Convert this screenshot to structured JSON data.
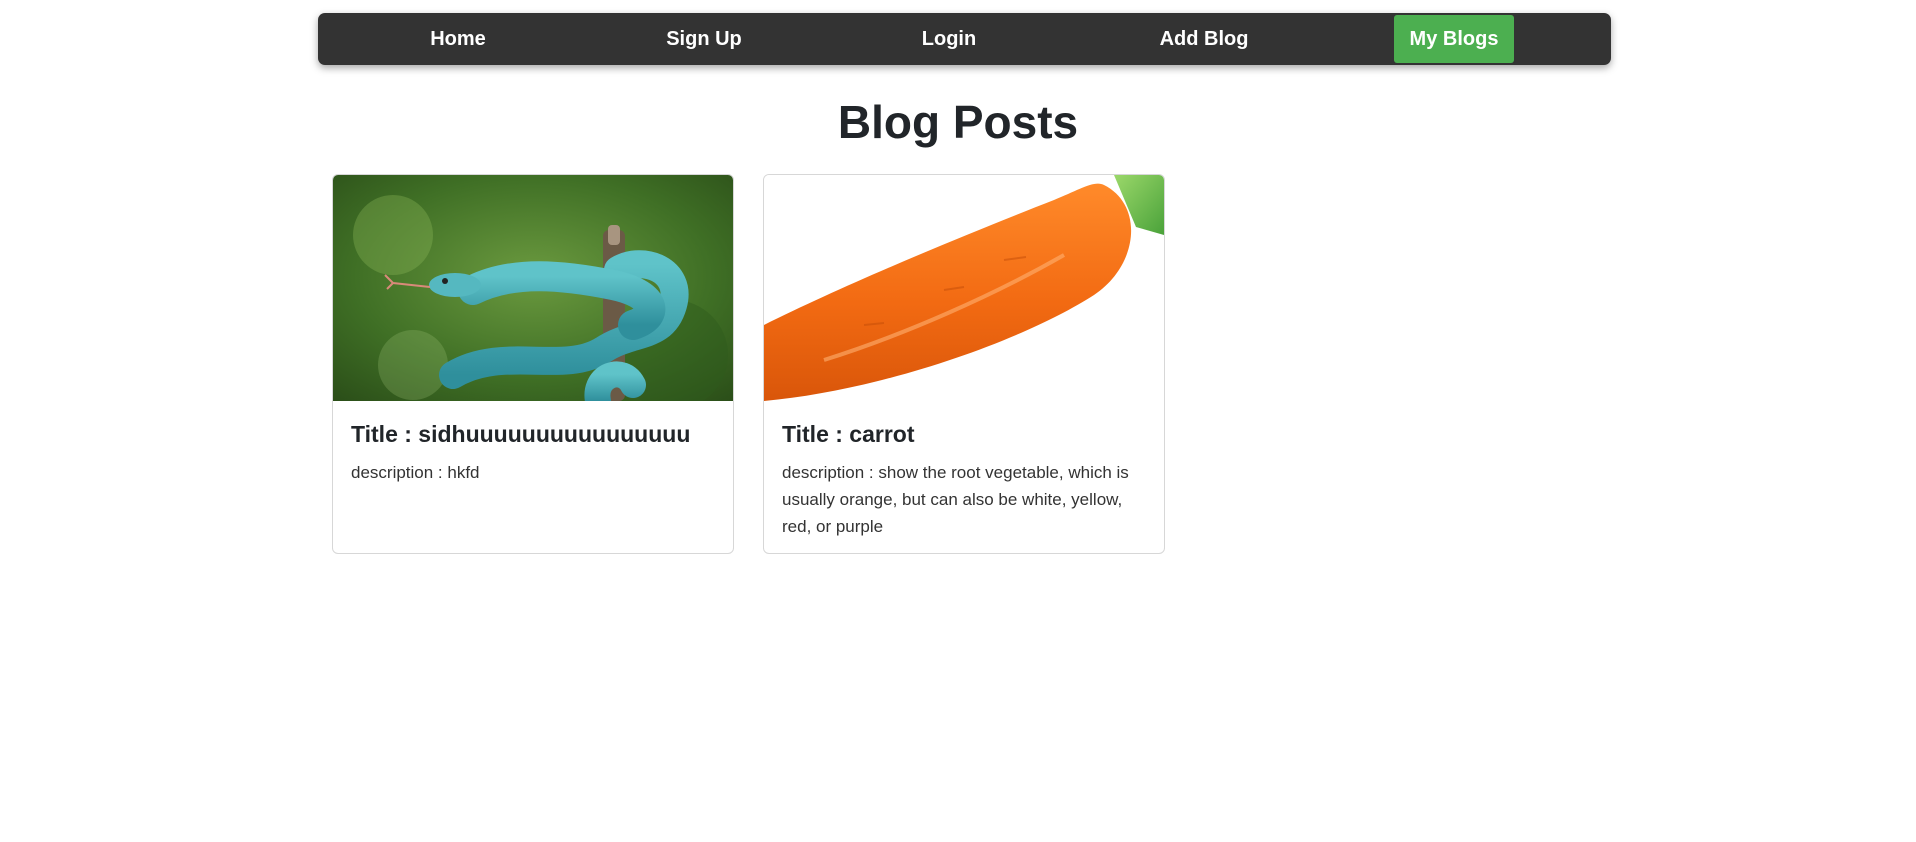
{
  "nav": {
    "items": [
      {
        "label": "Home"
      },
      {
        "label": "Sign Up"
      },
      {
        "label": "Login"
      },
      {
        "label": "Add Blog"
      },
      {
        "label": "My Blogs",
        "active": true
      }
    ]
  },
  "colors": {
    "navbar_bg": "#333333",
    "active_bg": "#4caf50",
    "nav_text": "#ffffff"
  },
  "page": {
    "title": "Blog Posts"
  },
  "posts": [
    {
      "title": "Title : sidhuuuuuuuuuuuuuuuu",
      "description": "description : hkfd",
      "image_icon": "snake-photo"
    },
    {
      "title": "Title : carrot",
      "description": "description : show the root vegetable, which is usually orange, but can also be white, yellow, red, or purple",
      "image_icon": "carrot-photo"
    }
  ]
}
